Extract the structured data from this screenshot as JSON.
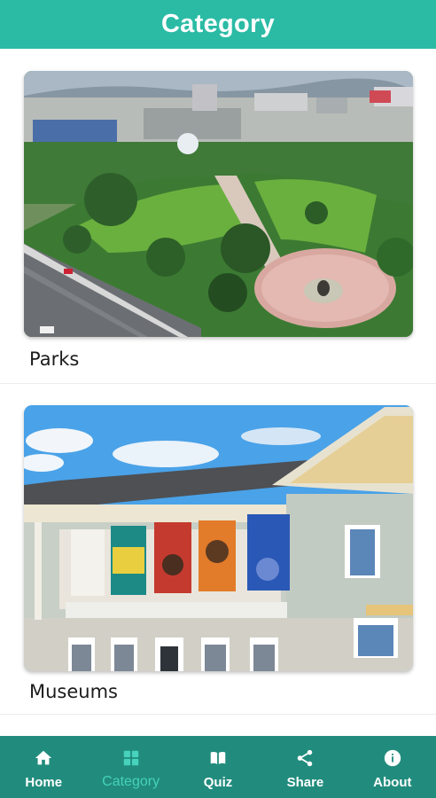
{
  "header": {
    "title": "Category"
  },
  "categories": [
    {
      "label": "Parks",
      "image": "aerial-park-photo"
    },
    {
      "label": "Museums",
      "image": "museum-building-photo"
    }
  ],
  "nav": {
    "items": [
      {
        "label": "Home",
        "icon": "home-icon",
        "active": false
      },
      {
        "label": "Category",
        "icon": "grid-icon",
        "active": true
      },
      {
        "label": "Quiz",
        "icon": "book-icon",
        "active": false
      },
      {
        "label": "Share",
        "icon": "share-icon",
        "active": false
      },
      {
        "label": "About",
        "icon": "info-icon",
        "active": false
      }
    ]
  },
  "colors": {
    "header": "#2bbba5",
    "nav": "#218c7d",
    "nav_active": "#46d2bc"
  }
}
